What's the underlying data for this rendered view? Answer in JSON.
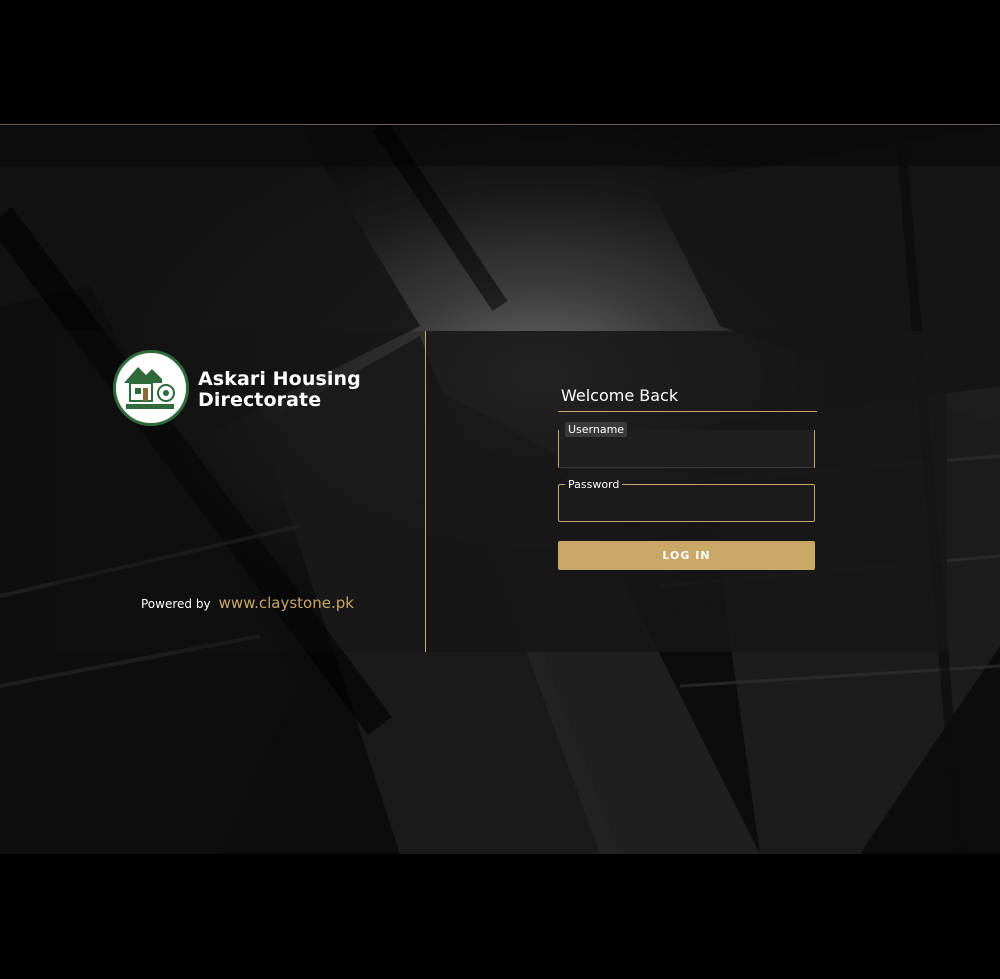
{
  "brand": {
    "name_line1": "Askari Housing",
    "name_line2": "Directorate",
    "logo_icon": "ahd-logo-icon",
    "logo_text": "ASKARI HOUSING DIRECTORATE"
  },
  "footer": {
    "powered_by": "Powered by",
    "link_text": "www.claystone.pk"
  },
  "login": {
    "title": "Welcome Back",
    "username_label": "Username",
    "username_value": "",
    "password_label": "Password",
    "password_value": "",
    "button_label": "LOG IN"
  },
  "colors": {
    "accent": "#c9a766",
    "panel_dark": "#161616",
    "logo_green": "#2f6b3a",
    "page_bg": "#000000",
    "text": "#ffffff"
  }
}
